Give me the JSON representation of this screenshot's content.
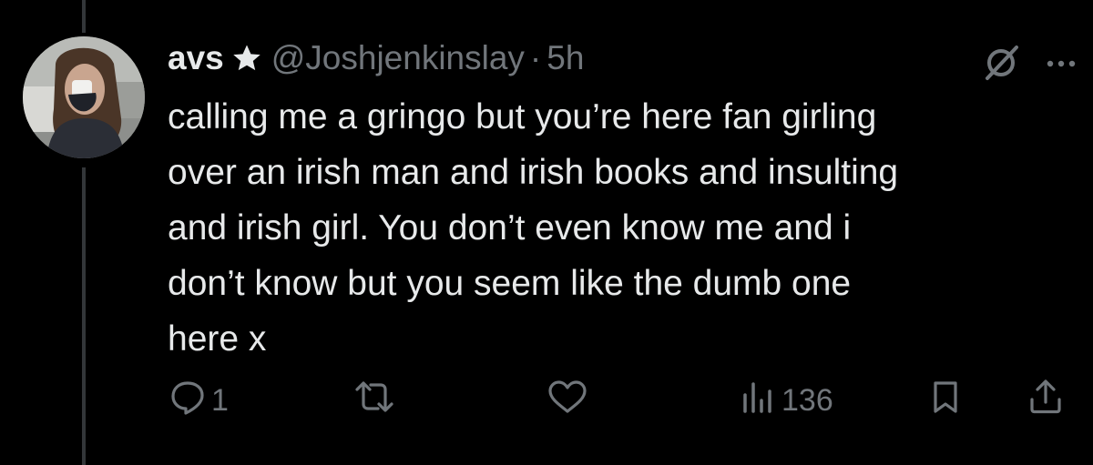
{
  "tweet": {
    "author": {
      "display_name": "avs",
      "handle": "@Joshjenkinslay",
      "separator": "·",
      "time": "5h"
    },
    "text_lines": [
      "calling me a gringo but you’re here fan girling",
      "over an irish man and irish books and insulting",
      "and irish girl. You don’t even know me and i",
      "don’t know but you seem like the dumb one",
      "here x"
    ],
    "stats": {
      "replies": "1",
      "views": "136"
    }
  },
  "icons": {
    "verified_badge": "star-icon",
    "top_right": [
      "grok-icon",
      "more-icon"
    ],
    "actions": [
      "reply-icon",
      "retweet-icon",
      "like-icon",
      "views-icon",
      "bookmark-icon",
      "share-icon"
    ]
  },
  "colors": {
    "background": "#000000",
    "primary_text": "#e7e9ea",
    "secondary_text": "#71767b",
    "thread_line": "#333639"
  }
}
